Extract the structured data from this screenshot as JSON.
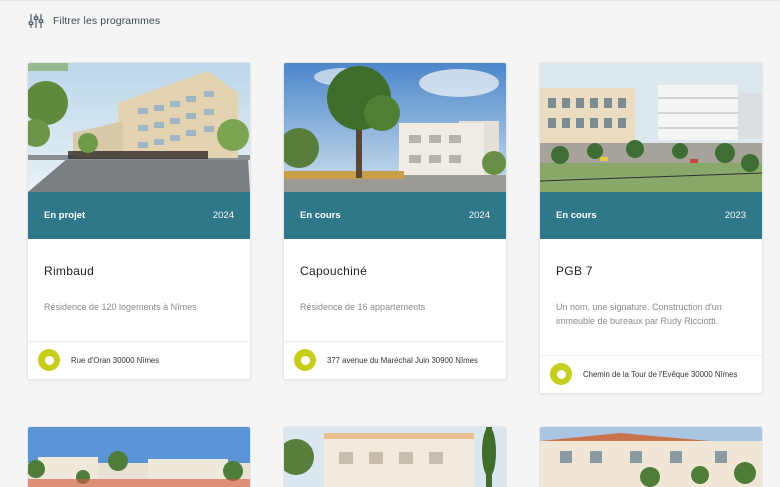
{
  "filter": {
    "label": "Filtrer les programmes",
    "icon": "sliders-icon"
  },
  "programs": [
    {
      "status": "En projet",
      "year": "2024",
      "name": "Rimbaud",
      "description": "Résidence de 120 logements à Nîmes",
      "address": "Rue d'Oran 30000 Nîmes"
    },
    {
      "status": "En cours",
      "year": "2024",
      "name": "Capouchiné",
      "description": "Résidence de 16 appartements",
      "address": "377 avenue du Maréchal Juin 30900 Nîmes"
    },
    {
      "status": "En cours",
      "year": "2023",
      "name": "PGB 7",
      "description": "Un nom, une signature. Construction d'un immeuble de bureaux par Rudy Ricciotti.",
      "address": "Chemin de la Tour de l'Evêque 30000 Nîmes"
    }
  ],
  "colors": {
    "band": "#2e7889",
    "pin": "#c6cf1c",
    "background": "#f5f5f5"
  }
}
